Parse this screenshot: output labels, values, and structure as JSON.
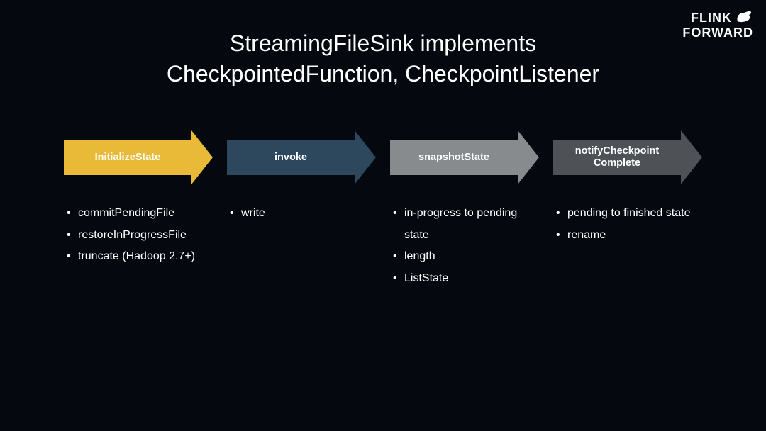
{
  "logo": {
    "line1": "FLINK",
    "line2": "FORWARD"
  },
  "title": {
    "line1": "StreamingFileSink implements",
    "line2": "CheckpointedFunction, CheckpointListener"
  },
  "steps": [
    {
      "label": "InitializeState",
      "color": "yellow",
      "bullets": [
        "commitPendingFile",
        "restoreInProgressFile",
        "truncate (Hadoop 2.7+)"
      ]
    },
    {
      "label": "invoke",
      "color": "blue",
      "bullets": [
        "write"
      ]
    },
    {
      "label": "snapshotState",
      "color": "gray",
      "bullets": [
        "in-progress to pending state",
        "length",
        "ListState"
      ]
    },
    {
      "label": "notifyCheckpoint\nComplete",
      "color": "dark",
      "bullets": [
        "pending to finished state",
        "rename"
      ]
    }
  ]
}
